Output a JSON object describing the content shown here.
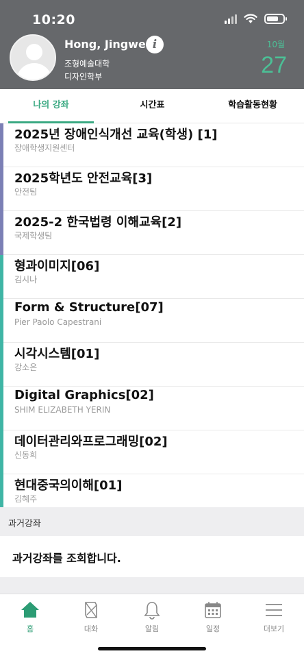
{
  "status_bar": {
    "time": "10:20"
  },
  "profile": {
    "name": "Hong, Jingwen",
    "college": "조형예술대학",
    "department": "디자인학부",
    "date": {
      "month": "10월",
      "day": "27"
    }
  },
  "tabs": [
    {
      "label": "나의 강좌",
      "active": true
    },
    {
      "label": "시간표",
      "active": false
    },
    {
      "label": "학습활동현황",
      "active": false
    }
  ],
  "courses": [
    {
      "title": "2025년 장애인식개선 교육(학생) [1]",
      "instructor": "장애학생지원센터",
      "bar_color": "#7b7fb5"
    },
    {
      "title": "2025학년도 안전교육[3]",
      "instructor": "안전팀",
      "bar_color": "#7b7fb5"
    },
    {
      "title": "2025-2 한국법령 이해교육[2]",
      "instructor": "국제학생팀",
      "bar_color": "#7b7fb5"
    },
    {
      "title": "형과이미지[06]",
      "instructor": "김시나",
      "bar_color": "#3fb5a5"
    },
    {
      "title": "Form & Structure[07]",
      "instructor": "Pier Paolo Capestrani",
      "bar_color": "#3fb5a5"
    },
    {
      "title": "시각시스템[01]",
      "instructor": "강소은",
      "bar_color": "#3fb5a5"
    },
    {
      "title": "Digital Graphics[02]",
      "instructor": "SHIM ELIZABETH YERIN",
      "bar_color": "#3fb5a5"
    },
    {
      "title": "데이터관리와프로그래밍[02]",
      "instructor": "신동희",
      "bar_color": "#3fb5a5"
    },
    {
      "title": "현대중국의이해[01]",
      "instructor": "김혜주",
      "bar_color": "#3fb5a5"
    }
  ],
  "past_courses": {
    "header": "과거강좌",
    "action": "과거강좌를 조회합니다."
  },
  "bottom_nav": [
    {
      "label": "홈",
      "icon": "home-icon",
      "active": true
    },
    {
      "label": "대화",
      "icon": "chat-icon",
      "active": false
    },
    {
      "label": "알림",
      "icon": "bell-icon",
      "active": false
    },
    {
      "label": "일정",
      "icon": "calendar-icon",
      "active": false
    },
    {
      "label": "더보기",
      "icon": "menu-icon",
      "active": false
    }
  ],
  "colors": {
    "accent": "#3aa982",
    "header_bg": "#66686b",
    "date_green": "#4cbf96"
  }
}
